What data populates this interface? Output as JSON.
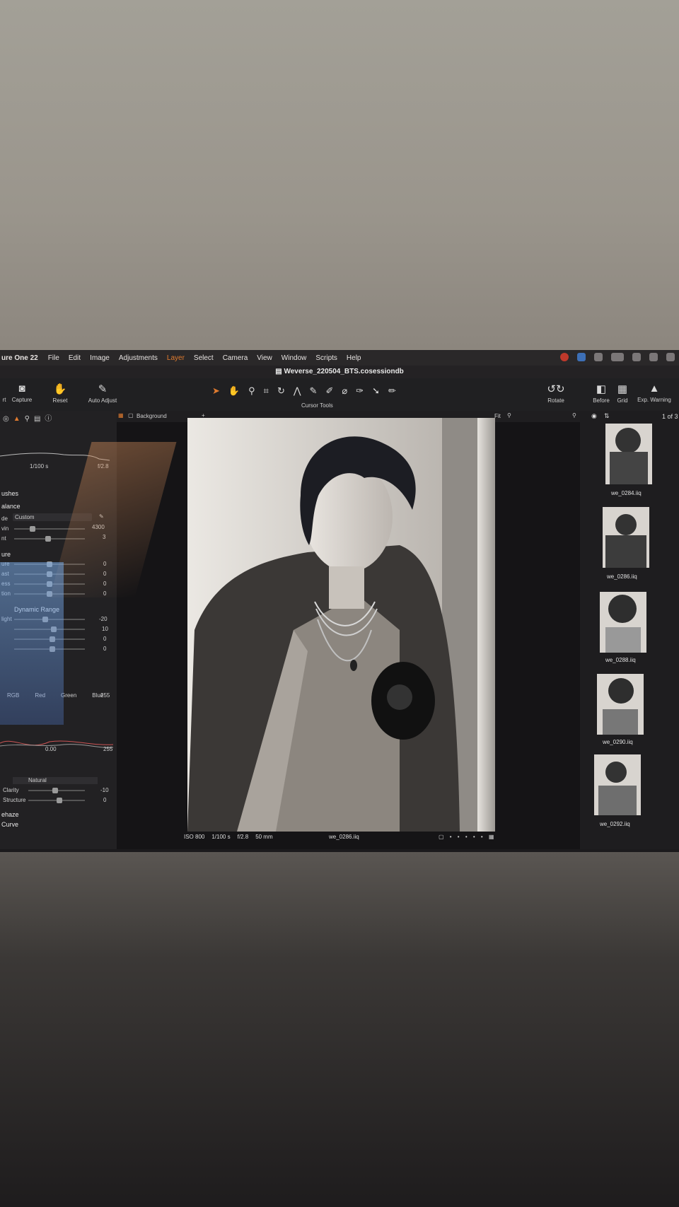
{
  "menubar": {
    "app_name": "ure One 22",
    "items": [
      "File",
      "Edit",
      "Image",
      "Adjustments",
      "Layer",
      "Select",
      "Camera",
      "View",
      "Window",
      "Scripts",
      "Help"
    ]
  },
  "window": {
    "title": "Weverse_220504_BTS.cosessiondb"
  },
  "toolbar": {
    "left": [
      {
        "label": "rt",
        "icon": "import-icon"
      },
      {
        "label": "Capture",
        "icon": "camera-icon"
      },
      {
        "label": "Reset",
        "icon": "reset-icon"
      },
      {
        "label": "Auto Adjust",
        "icon": "wand-icon"
      }
    ],
    "cursor_tools_label": "Cursor Tools",
    "right": [
      {
        "label": "Rotate",
        "icon": "rotate-icon"
      },
      {
        "label": "Before",
        "icon": "before-icon"
      },
      {
        "label": "Grid",
        "icon": "grid-icon"
      },
      {
        "label": "Exp. Warning",
        "icon": "warning-icon"
      }
    ]
  },
  "left_panel": {
    "histogram": {
      "shutter": "1/100 s",
      "aperture": "f/2.8"
    },
    "brushes_label": "ushes",
    "white_balance": {
      "title": "alance",
      "mode_label": "de",
      "mode_value": "Custom",
      "kelvin_label": "vin",
      "kelvin_value": "4300",
      "tint_label": "nt",
      "tint_value": "3"
    },
    "exposure": {
      "title": "ure",
      "rows": [
        {
          "label": "ure",
          "value": "0"
        },
        {
          "label": "ast",
          "value": "0"
        },
        {
          "label": "ess",
          "value": "0"
        },
        {
          "label": "tion",
          "value": "0"
        }
      ]
    },
    "hdr": {
      "title": "Dynamic Range",
      "rows": [
        {
          "label": "light",
          "value": "-20"
        },
        {
          "label": "",
          "value": "10"
        },
        {
          "label": "",
          "value": "0"
        },
        {
          "label": "",
          "value": "0"
        }
      ]
    },
    "levels": {
      "channels": [
        "RGB",
        "Red",
        "Green",
        "Blue"
      ],
      "low": "0.00",
      "high": "255",
      "top": "255"
    },
    "clarity": {
      "method": "Natural",
      "rows": [
        {
          "label": "Clarity",
          "value": "-10"
        },
        {
          "label": "Structure",
          "value": "0"
        }
      ]
    },
    "dehaze_label": "ehaze",
    "curve_label": "Curve"
  },
  "viewer": {
    "layer_name": "Background",
    "zoom": "Fit",
    "meta": {
      "iso": "ISO 800",
      "shutter": "1/100 s",
      "aperture": "f/2.8",
      "focal": "50 mm"
    },
    "filename": "we_0286.iiq"
  },
  "browser": {
    "count": "1 of 3",
    "thumbs": [
      "we_0284.iiq",
      "we_0286.iiq",
      "we_0288.iiq",
      "we_0290.iiq",
      "we_0292.iiq"
    ]
  }
}
